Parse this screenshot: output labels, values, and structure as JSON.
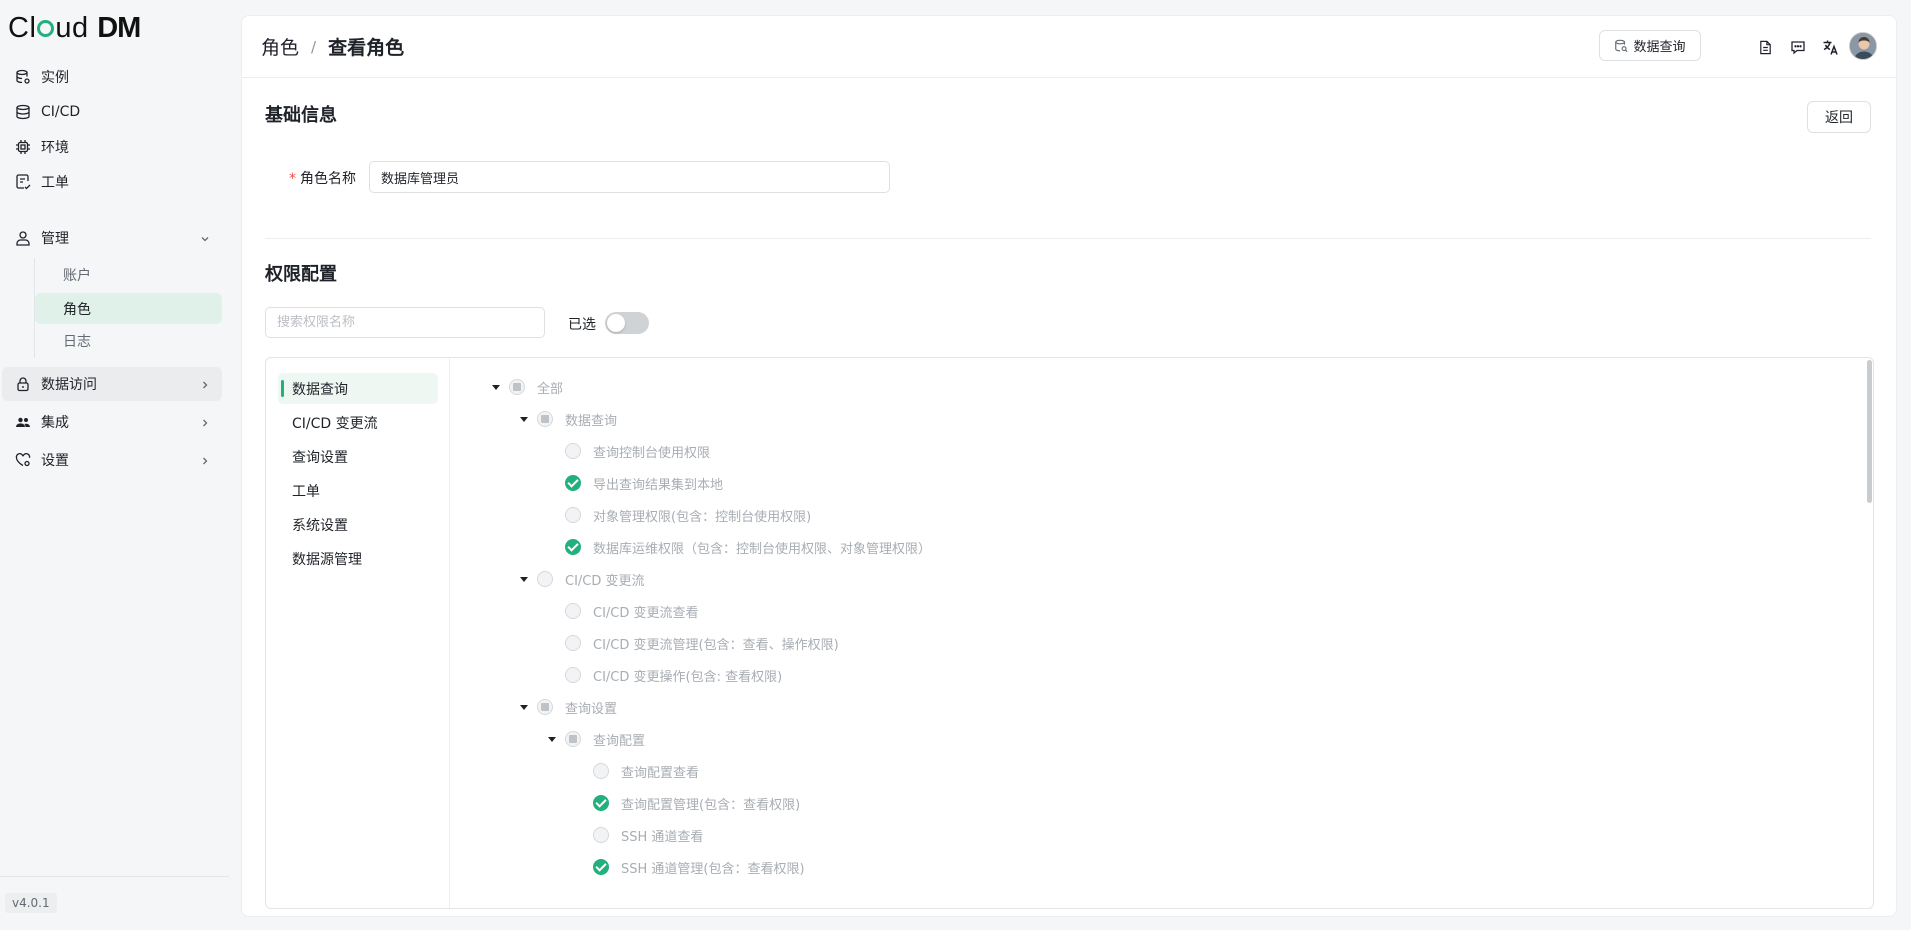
{
  "app": {
    "logo_prefix": "Cl",
    "logo_mid": "ud",
    "logo_suffix": "DM",
    "version": "v4.0.1"
  },
  "sidebar": {
    "items": [
      {
        "label": "实例"
      },
      {
        "label": "CI/CD"
      },
      {
        "label": "环境"
      },
      {
        "label": "工单"
      }
    ],
    "manage": {
      "label": "管理",
      "children": [
        {
          "label": "账户"
        },
        {
          "label": "角色"
        },
        {
          "label": "日志"
        }
      ]
    },
    "data_access": {
      "label": "数据访问"
    },
    "integration": {
      "label": "集成"
    },
    "settings": {
      "label": "设置"
    }
  },
  "header": {
    "crumb_parent": "角色",
    "crumb_sep": "/",
    "crumb_current": "查看角色",
    "query_button": "数据查询"
  },
  "basic": {
    "title": "基础信息",
    "back_button": "返回",
    "required_mark": "*",
    "name_label": "角色名称",
    "name_value": "数据库管理员"
  },
  "perm": {
    "title": "权限配置",
    "search_placeholder": "搜索权限名称",
    "selected_label": "已选",
    "selected_on": false,
    "categories": [
      "数据查询",
      "CI/CD 变更流",
      "查询设置",
      "工单",
      "系统设置",
      "数据源管理"
    ],
    "tree": [
      {
        "label": "全部",
        "state": "indeterminate"
      },
      {
        "label": "数据查询",
        "state": "indeterminate"
      },
      {
        "label": "查询控制台使用权限",
        "state": "unchecked"
      },
      {
        "label": "导出查询结果集到本地",
        "state": "checked"
      },
      {
        "label": "对象管理权限(包含：控制台使用权限)",
        "state": "unchecked"
      },
      {
        "label": "数据库运维权限（包含：控制台使用权限、对象管理权限）",
        "state": "checked"
      },
      {
        "label": "CI/CD 变更流",
        "state": "unchecked"
      },
      {
        "label": "CI/CD 变更流查看",
        "state": "unchecked"
      },
      {
        "label": "CI/CD 变更流管理(包含：查看、操作权限)",
        "state": "unchecked"
      },
      {
        "label": "CI/CD 变更操作(包含: 查看权限)",
        "state": "unchecked"
      },
      {
        "label": "查询设置",
        "state": "indeterminate"
      },
      {
        "label": "查询配置",
        "state": "indeterminate"
      },
      {
        "label": "查询配置查看",
        "state": "unchecked"
      },
      {
        "label": "查询配置管理(包含：查看权限)",
        "state": "checked"
      },
      {
        "label": "SSH 通道查看",
        "state": "unchecked"
      },
      {
        "label": "SSH 通道管理(包含：查看权限)",
        "state": "checked"
      }
    ]
  },
  "colors": {
    "accent": "#22b07d",
    "active_bg": "#dff1e8",
    "required": "#f54a45"
  }
}
